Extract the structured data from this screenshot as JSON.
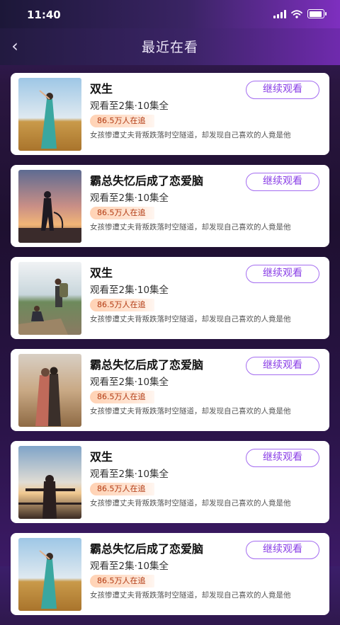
{
  "status_bar": {
    "time": "11:40"
  },
  "header": {
    "title": "最近在看",
    "back_icon": "chevron-left-icon"
  },
  "items": [
    {
      "title": "双生",
      "progress": "观看至2集·10集全",
      "viewers": "86.5万人在追",
      "description": "女孩惨遭丈夫背叛跌落时空隧道，却发现自己喜欢的人竟是他",
      "button": "继续观看"
    },
    {
      "title": "霸总失忆后成了恋爱脑",
      "progress": "观看至2集·10集全",
      "viewers": "86.5万人在追",
      "description": "女孩惨遭丈夫背叛跌落时空隧道，却发现自己喜欢的人竟是他",
      "button": "继续观看"
    },
    {
      "title": "双生",
      "progress": "观看至2集·10集全",
      "viewers": "86.5万人在追",
      "description": "女孩惨遭丈夫背叛跌落时空隧道，却发现自己喜欢的人竟是他",
      "button": "继续观看"
    },
    {
      "title": "霸总失忆后成了恋爱脑",
      "progress": "观看至2集·10集全",
      "viewers": "86.5万人在追",
      "description": "女孩惨遭丈夫背叛跌落时空隧道，却发现自己喜欢的人竟是他",
      "button": "继续观看"
    },
    {
      "title": "双生",
      "progress": "观看至2集·10集全",
      "viewers": "86.5万人在追",
      "description": "女孩惨遭丈夫背叛跌落时空隧道，却发现自己喜欢的人竟是他",
      "button": "继续观看"
    },
    {
      "title": "霸总失忆后成了恋爱脑",
      "progress": "观看至2集·10集全",
      "viewers": "86.5万人在追",
      "description": "女孩惨遭丈夫背叛跌落时空隧道，却发现自己喜欢的人竟是他",
      "button": "继续观看"
    }
  ]
}
